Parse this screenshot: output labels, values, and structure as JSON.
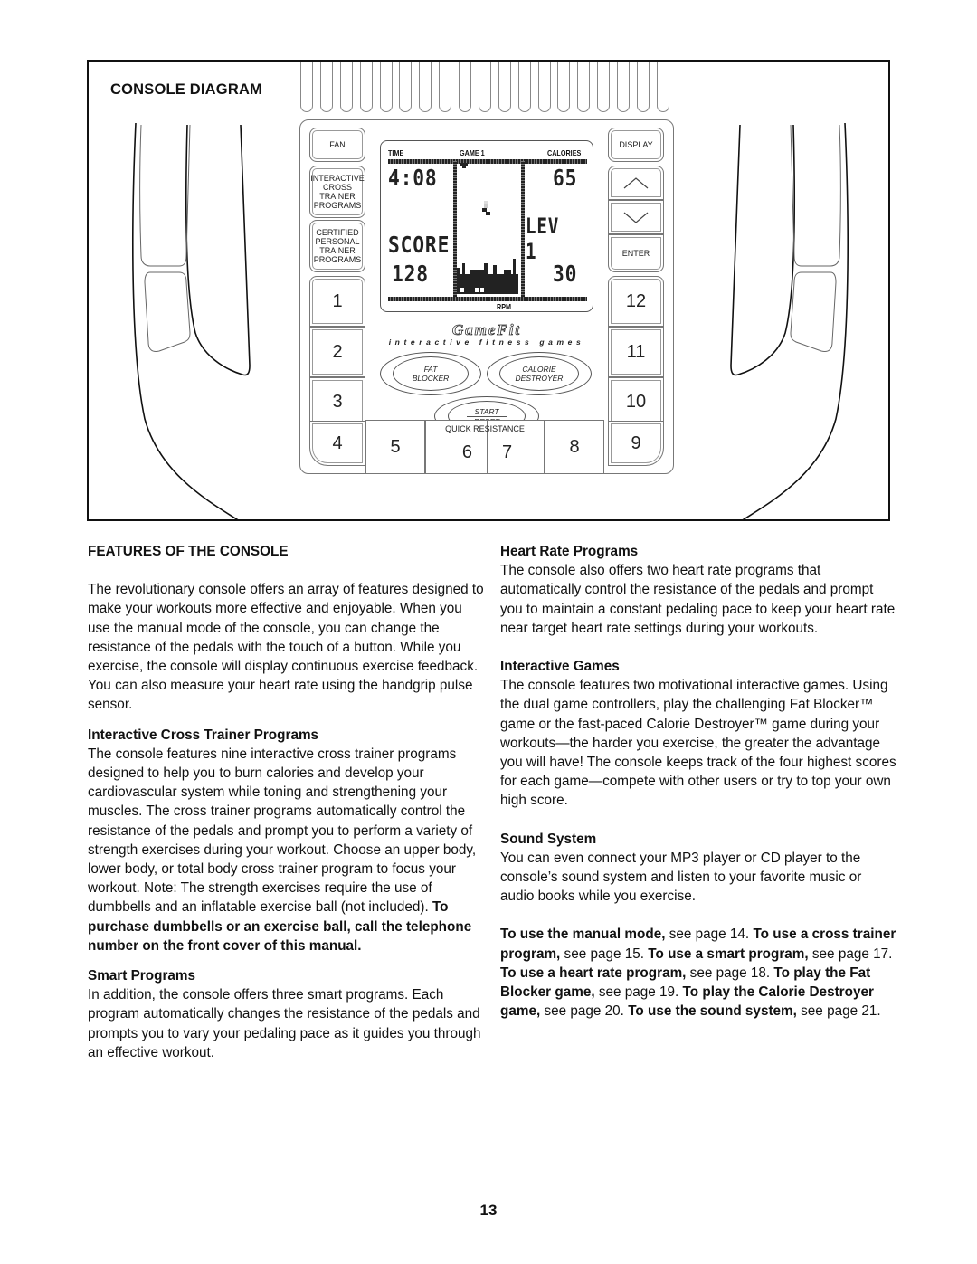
{
  "diagram": {
    "title": "CONSOLE DIAGRAM",
    "console": {
      "left_buttons": [
        {
          "label": "FAN"
        },
        {
          "label": "INTERACTIVE CROSS TRAINER PROGRAMS",
          "lines": [
            "INTERACTIVE",
            "CROSS",
            "TRAINER",
            "PROGRAMS"
          ]
        },
        {
          "label": "CERTIFIED PERSONAL TRAINER PROGRAMS",
          "lines": [
            "CERTIFIED",
            "PERSONAL",
            "TRAINER",
            "PROGRAMS"
          ]
        }
      ],
      "right_buttons": [
        {
          "label": "DISPLAY"
        },
        {
          "label": "up",
          "icon": "chevron-up-icon"
        },
        {
          "label": "down",
          "icon": "chevron-down-icon"
        },
        {
          "label": "ENTER"
        }
      ],
      "left_numbers": [
        "1",
        "2",
        "3",
        "4"
      ],
      "right_numbers": [
        "12",
        "11",
        "10",
        "9"
      ],
      "bottom_numbers": [
        "5",
        "6",
        "7",
        "8"
      ],
      "quick_resistance_label": "QUICK RESISTANCE",
      "display": {
        "time_label": "TIME",
        "game_label": "GAME 1",
        "calories_label": "CALORIES",
        "rpm_label": "RPM",
        "time_value": "4:08",
        "calories_value": "65",
        "level_value": "LEV 1",
        "score_label": "SCORE",
        "score_value": "128",
        "rpm_value": "30"
      },
      "brand": {
        "logo": "GameFit",
        "tagline": "interactive fitness games"
      },
      "game_buttons": {
        "fat_blocker": [
          "FAT",
          "BLOCKER"
        ],
        "calorie_destroyer": [
          "CALORIE",
          "DESTROYER"
        ],
        "start": "START",
        "reset": "RESET"
      }
    }
  },
  "left_column": {
    "heading": "FEATURES OF THE CONSOLE",
    "intro": "The revolutionary console offers an array of features designed to make your workouts more effective and enjoyable. When you use the manual mode of the console, you can change the resistance of the pedals with the touch of a button. While you exercise, the console will display continuous exercise feedback. You can also measure your heart rate using the handgrip pulse sensor.",
    "sections": [
      {
        "title": "Interactive Cross Trainer Programs",
        "body": "The console features nine interactive cross trainer programs designed to help you to burn calories and develop your cardiovascular system while toning and strengthening your muscles. The cross trainer programs automatically control the resistance of the pedals and prompt you to perform a variety of strength exercises during your workout. Choose an upper body, lower body, or total body cross trainer program to focus your workout. Note: The strength exercises require the use of dumbbells and an inflatable exercise ball (not included). ",
        "body_bold": "To purchase dumbbells or an exercise ball, call the telephone number on the front cover of this manual."
      },
      {
        "title": "Smart Programs",
        "body": "In addition, the console offers three smart programs. Each program automatically changes the resistance of the pedals and prompts you to vary your pedaling pace as it guides you through an effective workout."
      }
    ]
  },
  "right_column": {
    "sections": [
      {
        "title": "Heart Rate Programs",
        "body": "The console also offers two heart rate programs that automatically control the resistance of the pedals and prompt you to maintain a constant pedaling pace to keep your heart rate near target heart rate settings during your workouts."
      },
      {
        "title": "Interactive Games",
        "body": "The console features two motivational interactive games. Using the dual game controllers, play the challenging Fat Blocker™ game or the fast-paced Calorie Destroyer™ game during your workouts—the harder you exercise, the greater the advantage you will have! The console keeps track of the four highest scores for each game—compete with other users or try to top your own high score."
      },
      {
        "title": "Sound System",
        "body": "You can even connect your MP3 player or CD player to the console’s sound system and listen to your favorite music or audio books while you exercise."
      }
    ],
    "references": [
      {
        "bold": "To use the manual mode,",
        "text": " see page 14. "
      },
      {
        "bold": "To use a cross trainer program,",
        "text": " see page 15. "
      },
      {
        "bold": "To use a smart program,",
        "text": " see page 17. "
      },
      {
        "bold": "To use a heart rate program,",
        "text": " see page 18. "
      },
      {
        "bold": "To play the Fat Blocker game,",
        "text": " see page 19. "
      },
      {
        "bold": "To play the Calorie Destroyer game,",
        "text": " see page 20. "
      },
      {
        "bold": "To use the sound system,",
        "text": " see page 21."
      }
    ]
  },
  "page_number": "13"
}
